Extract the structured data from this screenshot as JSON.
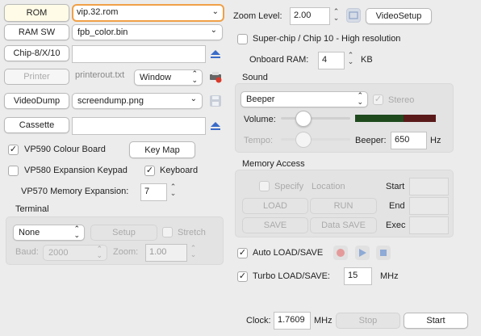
{
  "rom": {
    "rom_label": "ROM",
    "rom_value": "vip.32.rom",
    "ramsw_label": "RAM SW",
    "ramsw_value": "fpb_color.bin",
    "chip8_label": "Chip-8/X/10",
    "chip8_value": "",
    "printer_label": "Printer",
    "printer_value": "printerout.txt",
    "printer_mode": "Window",
    "videodump_label": "VideoDump",
    "videodump_value": "screendump.png",
    "cassette_label": "Cassette",
    "cassette_value": ""
  },
  "options": {
    "vp590_label": "VP590 Colour Board",
    "vp590_checked": true,
    "keymap_label": "Key Map",
    "vp580_label": "VP580 Expansion Keypad",
    "vp580_checked": false,
    "keyboard_label": "Keyboard",
    "keyboard_checked": true,
    "vp570_label": "VP570 Memory Expansion:",
    "vp570_value": "7"
  },
  "terminal": {
    "title": "Terminal",
    "type_value": "None",
    "setup_label": "Setup",
    "stretch_label": "Stretch",
    "baud_label": "Baud:",
    "baud_value": "2000",
    "zoom_label": "Zoom:",
    "zoom_value": "1.00"
  },
  "video": {
    "zoom_label": "Zoom Level:",
    "zoom_value": "2.00",
    "videosetup_label": "VideoSetup",
    "superchip_label": "Super-chip / Chip 10 - High resolution",
    "onboard_ram_label": "Onboard RAM:",
    "onboard_ram_value": "4",
    "onboard_ram_unit": "KB"
  },
  "sound": {
    "title": "Sound",
    "type_value": "Beeper",
    "stereo_label": "Stereo",
    "volume_label": "Volume:",
    "volume_level": 0.3,
    "tempo_label": "Tempo:",
    "tempo_level": 0.3,
    "beeper_label": "Beeper:",
    "beeper_value": "650",
    "beeper_unit": "Hz"
  },
  "memory": {
    "title": "Memory Access",
    "specify_label": "Specify",
    "location_label": "Location",
    "start_label": "Start",
    "end_label": "End",
    "exec_label": "Exec",
    "load_label": "LOAD",
    "run_label": "RUN",
    "save_label": "SAVE",
    "datasave_label": "Data SAVE"
  },
  "auto": {
    "auto_label": "Auto LOAD/SAVE",
    "auto_checked": true,
    "turbo_label": "Turbo LOAD/SAVE:",
    "turbo_checked": true,
    "turbo_value": "15",
    "turbo_unit": "MHz"
  },
  "clock": {
    "label": "Clock:",
    "value": "1.7609",
    "unit": "MHz",
    "stop_label": "Stop",
    "start_label": "Start"
  },
  "colors": {
    "focus_ring": "#f0a048",
    "level_green": "#1e4a1e",
    "level_red": "#5a1a1a"
  }
}
